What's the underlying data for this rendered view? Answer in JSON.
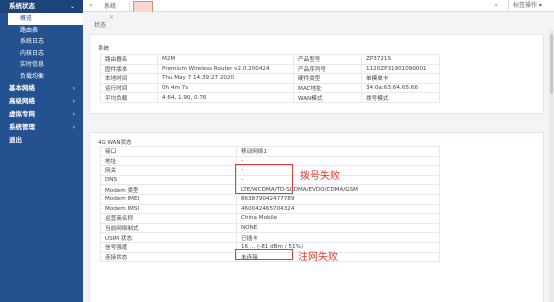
{
  "sidebar": {
    "groups": [
      {
        "label": "系统状态",
        "chevron": "⌄",
        "open": true,
        "items": [
          "概览",
          "路由表",
          "系统日志",
          "内核日志",
          "实时信息",
          "负载均衡"
        ],
        "active": 0
      },
      {
        "label": "基本网络",
        "chevron": "›"
      },
      {
        "label": "高级网络",
        "chevron": "›"
      },
      {
        "label": "虚拟专网",
        "chevron": "›"
      },
      {
        "label": "系统管理",
        "chevron": "›"
      },
      {
        "label": "退出",
        "chevron": ""
      }
    ]
  },
  "tabbar": {
    "left_arrow": "«",
    "tab1_label": "系统",
    "tab1_close": "✕",
    "right_arrow": "»",
    "right_label": "标签操作 ▾"
  },
  "breadcrumb": "状态",
  "system_panel": {
    "title": "系统",
    "rows": [
      [
        "路由器名",
        "M2M",
        "产品型号",
        "ZP3721S"
      ],
      [
        "固件版本",
        "Premium Wireless Router v2.0.200424",
        "产品序列号",
        "1120ZP31901090001"
      ],
      [
        "本地时间",
        "Thu May 7 14:39:27 2020",
        "硬件类型",
        "单模单卡"
      ],
      [
        "运行时间",
        "0h 4m 7s",
        "MAC地址",
        "34:0a:63:64:65:66"
      ],
      [
        "平均负载",
        "4.64, 1.90, 0.76",
        "WAN模式",
        "拨号模式"
      ]
    ]
  },
  "wan_panel": {
    "title": "4G WAN状态",
    "rows": [
      [
        "接口",
        "移动网络1"
      ],
      [
        "地址",
        "-"
      ],
      [
        "网关",
        "-"
      ],
      [
        "DNS",
        "-"
      ],
      [
        "Modem 类型",
        "LTE/WCDMA/TD-SCDMA/EVDO/CDMA/GSM"
      ],
      [
        "Modem IMEI",
        "863879042477789"
      ],
      [
        "Modem IMSI",
        "460042465704324"
      ],
      [
        "运营商名称",
        "China Mobile"
      ],
      [
        "当前网络制式",
        "NONE"
      ],
      [
        "USIM 状态",
        "已插卡"
      ],
      [
        "信号强度",
        "16 ... (-81 dBm / 51%)"
      ],
      [
        "连接状态",
        "未连接"
      ]
    ]
  },
  "annotations": {
    "dial_fail": "拨号失败",
    "register_fail": "注网失败",
    "color": "#e23a2e"
  },
  "colors": {
    "sidebar_bg": "#24518f",
    "active_tab_bg": "#f7d7cf"
  }
}
